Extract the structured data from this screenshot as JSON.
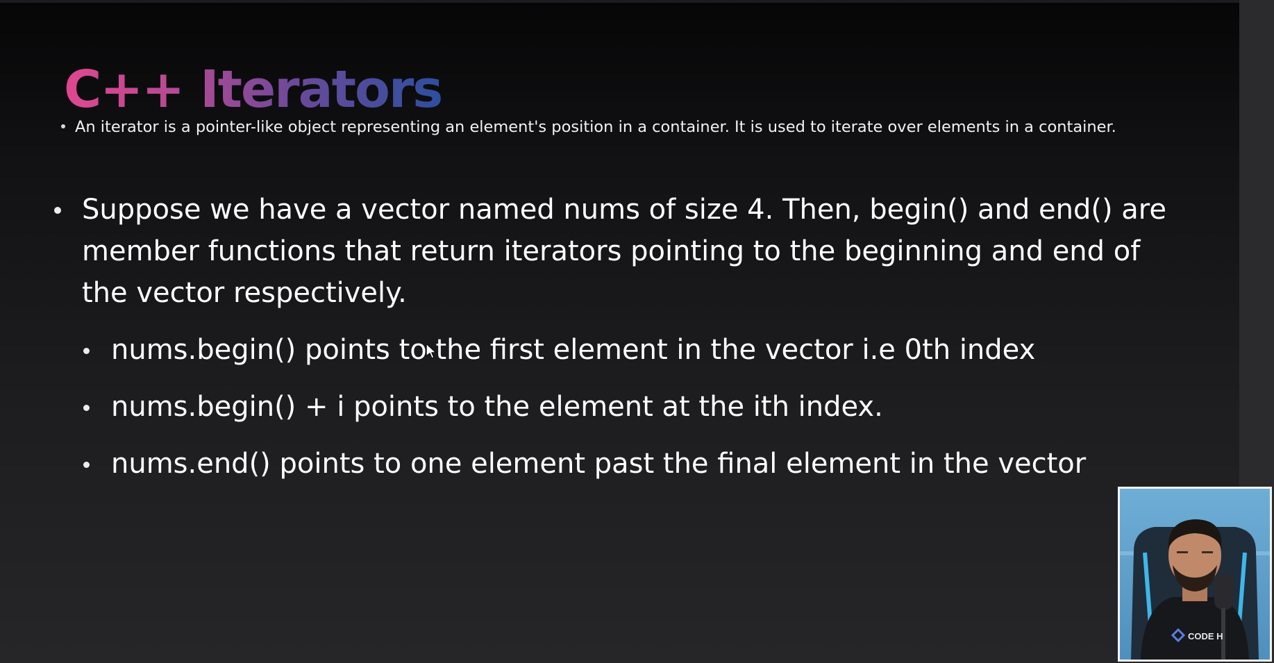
{
  "slide": {
    "title": "C++ Iterators",
    "subtitle": "An iterator is a pointer-like object representing an element's position in a container. It is used to iterate over elements in a container.",
    "main_point": "Suppose we have a vector named nums of size 4. Then, begin() and end() are member functions that return iterators pointing to the beginning and end of the vector respectively.",
    "sub_points": [
      "nums.begin() points to the first element in the vector i.e 0th index",
      "nums.begin() + i points to the element at the ith index.",
      "nums.end() points to one element past the final element in the vector"
    ]
  },
  "webcam": {
    "shirt_logo": "CODE H"
  },
  "colors": {
    "background": "#1a1a1c",
    "title_gradient_start": "#e0478f",
    "title_gradient_end": "#2d4f9e",
    "text": "#ffffff",
    "webcam_backdrop": "#5f9fc9"
  },
  "icons": [
    "bullet-dot",
    "mouse-cursor-icon",
    "presenter-webcam"
  ]
}
